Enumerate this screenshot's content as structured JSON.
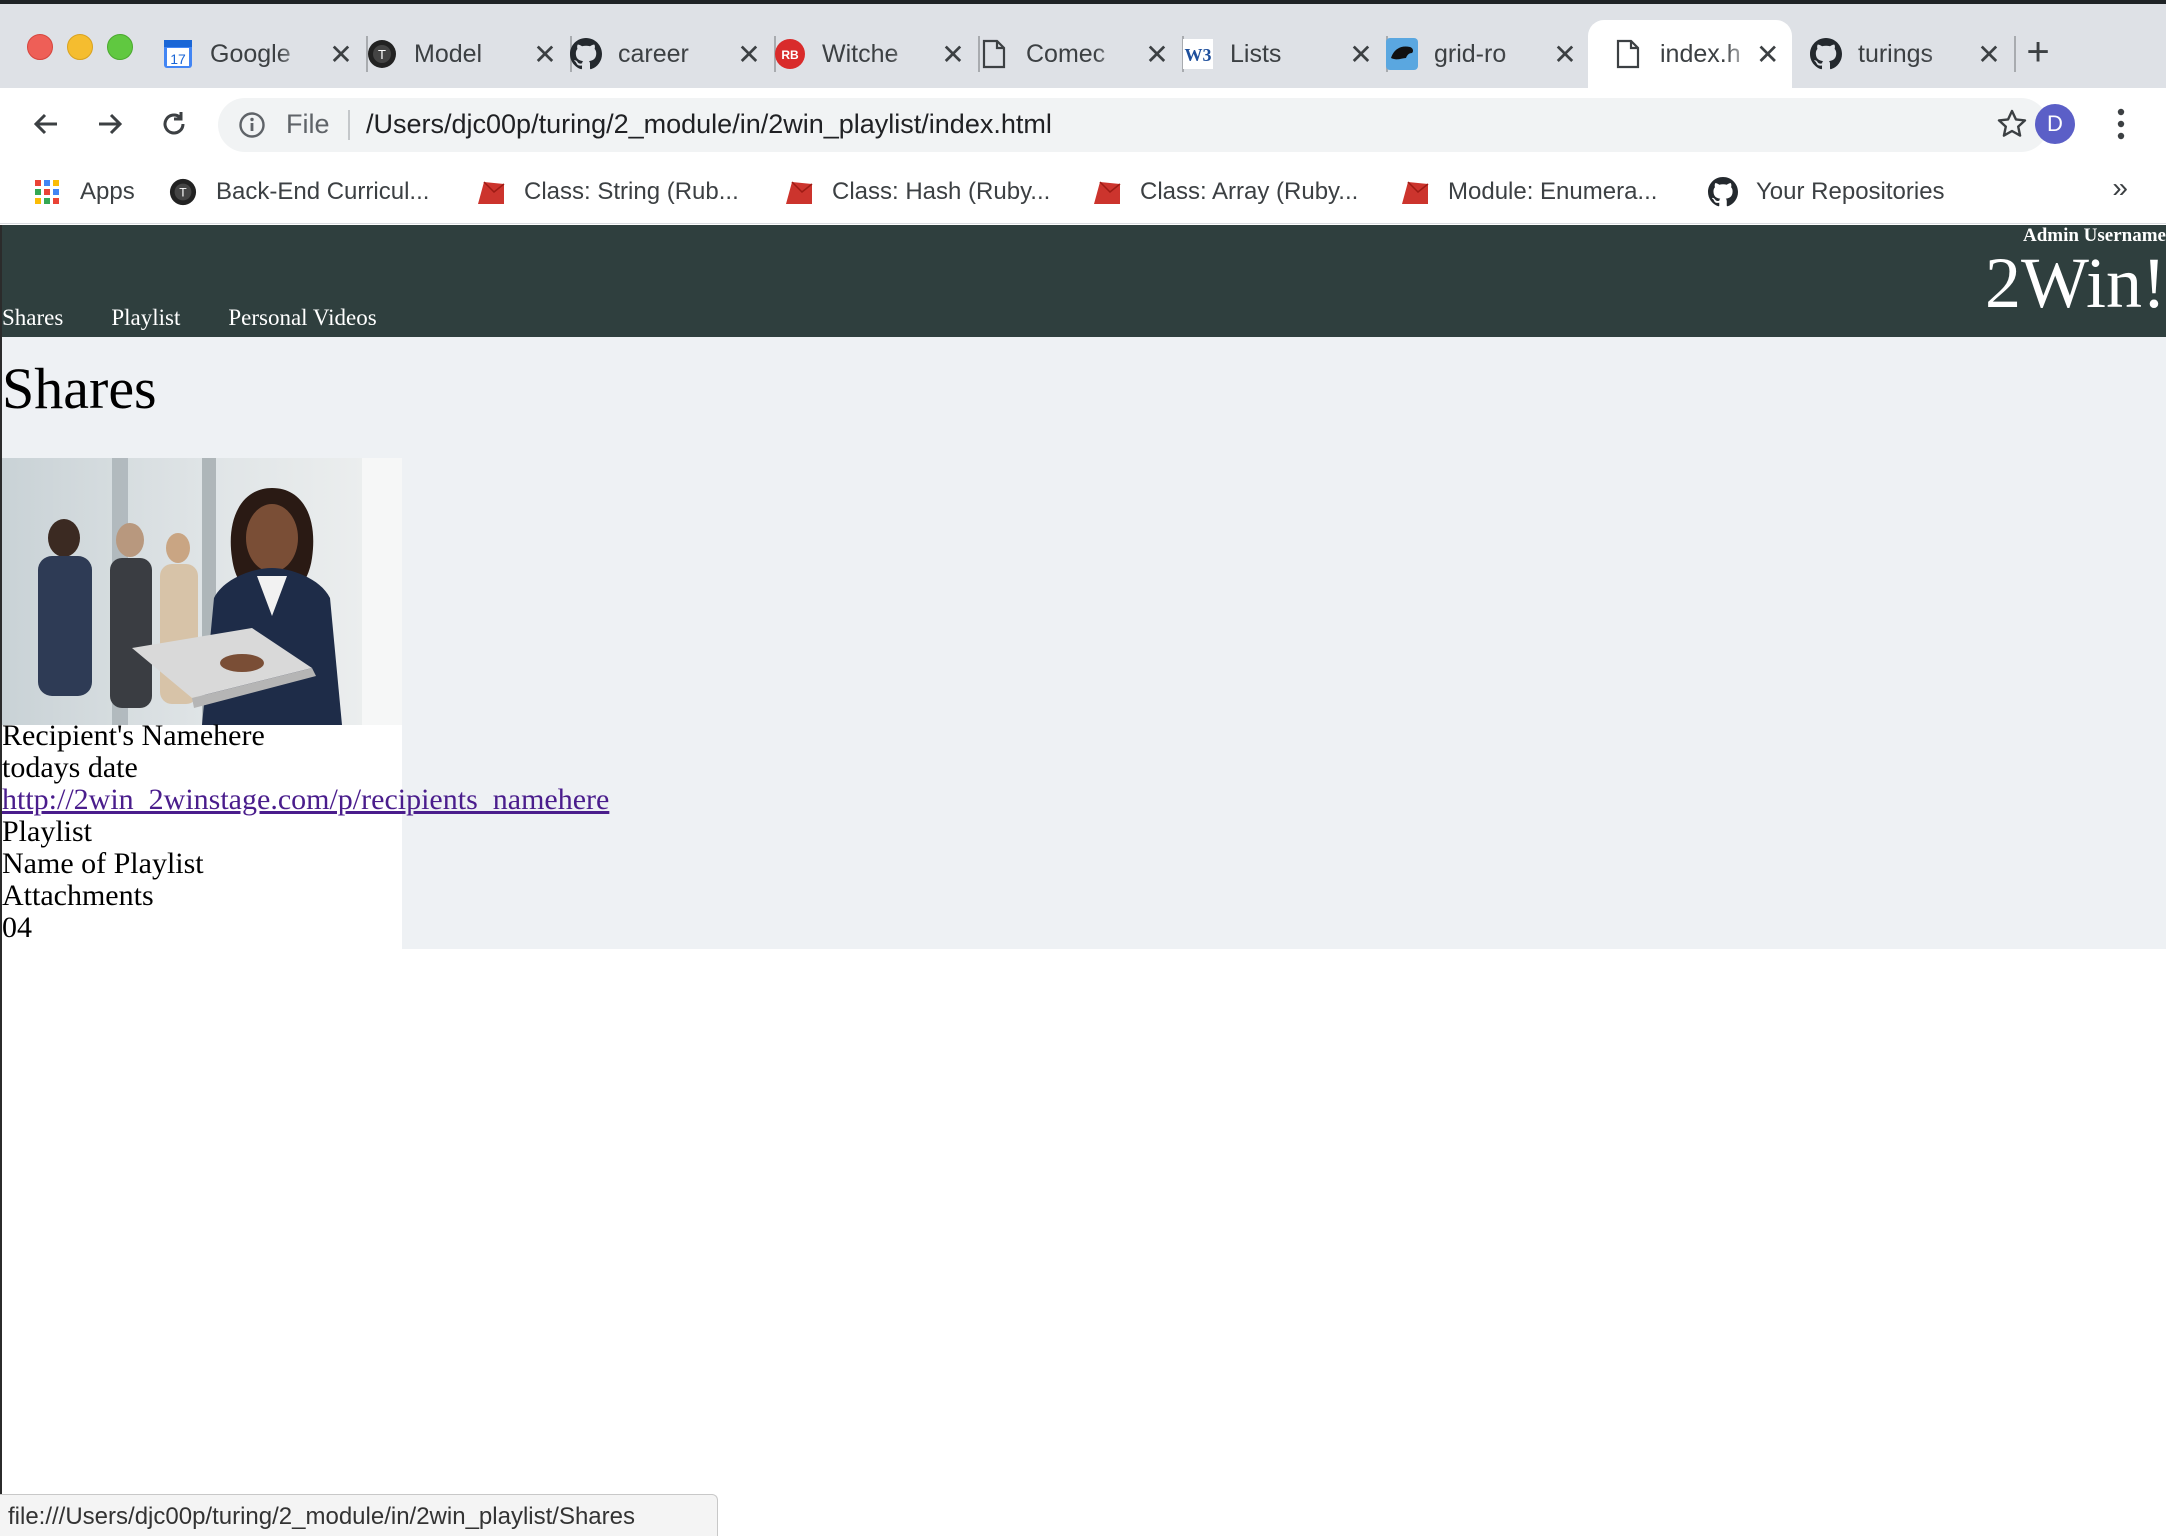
{
  "browser": {
    "tabs": [
      {
        "title": "Google",
        "icon": "google-calendar-icon",
        "icon_text": "17"
      },
      {
        "title": "Model",
        "icon": "turing-icon"
      },
      {
        "title": "career",
        "icon": "github-icon"
      },
      {
        "title": "Witche",
        "icon": "rubberduck-icon",
        "icon_text": "RB"
      },
      {
        "title": "Comec",
        "icon": "document-icon"
      },
      {
        "title": "Lists",
        "icon": "w3schools-icon",
        "icon_text": "W3"
      },
      {
        "title": "grid-ro",
        "icon": "panther-icon"
      },
      {
        "title": "index.h",
        "icon": "document-icon",
        "active": true
      },
      {
        "title": "turings",
        "icon": "github-icon"
      }
    ],
    "omnibox": {
      "scheme_label": "File",
      "url": "/Users/djc00p/turing/2_module/in/2win_playlist/index.html"
    },
    "profile_initial": "D",
    "bookmarks": [
      {
        "label": "Apps",
        "icon": "apps-grid-icon"
      },
      {
        "label": "Back-End Curricul...",
        "icon": "turing-icon"
      },
      {
        "label": "Class: String (Rub...",
        "icon": "ruby-icon"
      },
      {
        "label": "Class: Hash (Ruby...",
        "icon": "ruby-icon"
      },
      {
        "label": "Class: Array (Ruby...",
        "icon": "ruby-icon"
      },
      {
        "label": "Module: Enumera...",
        "icon": "ruby-icon"
      },
      {
        "label": "Your Repositories",
        "icon": "github-icon"
      }
    ],
    "bookmarks_more": "»",
    "status_url": "file:///Users/djc00p/turing/2_module/in/2win_playlist/Shares"
  },
  "site": {
    "admin_label": "Admin Username",
    "brand": "2Win!",
    "nav": [
      "Shares",
      "Playlist",
      "Personal Videos"
    ]
  },
  "shares": {
    "heading": "Shares",
    "card": {
      "recipient": "Recipient's Namehere",
      "date": "todays date",
      "link": "http://2win_2winstage.com/p/recipients_namehere",
      "playlist_label": "Playlist",
      "playlist_name": "Name of Playlist",
      "attachments_label": "Attachments",
      "attachments_count": "04"
    }
  },
  "colors": {
    "header_bg": "#2f3f3e",
    "section_bg": "#eef1f4",
    "tabstrip_bg": "#dee1e6",
    "visited_link": "#4a1d8c"
  }
}
